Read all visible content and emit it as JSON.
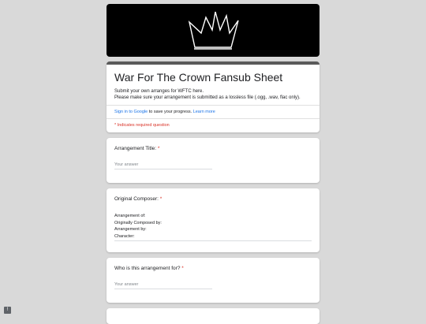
{
  "form": {
    "title": "War For The Crown Fansub Sheet",
    "description_line1": "Submit your own arranges for WFTC here.",
    "description_line2": "Please make sure your arrangement is submitted as a lossless file (.ogg, .wav, flac only).",
    "signin_link": "Sign in to Google",
    "signin_text": " to save your progress. ",
    "learn_more": "Learn more",
    "required_note": "* Indicates required question"
  },
  "questions": [
    {
      "label": "Arrangement Title:",
      "star": " *",
      "placeholder": "Your answer"
    },
    {
      "label": "Original Composer:",
      "star": " *",
      "lines": [
        "Arrangement of:",
        "Originally Composed by:",
        "Arrangement by:",
        "Character:"
      ]
    },
    {
      "label": "Who is this arrangement for?",
      "star": " *",
      "placeholder": "Your answer"
    }
  ],
  "icons": {
    "banner": "crown-icon",
    "feedback": "report-icon"
  },
  "colors": {
    "banner_bg": "#000000",
    "link": "#1a73e8",
    "required": "#d93025"
  }
}
